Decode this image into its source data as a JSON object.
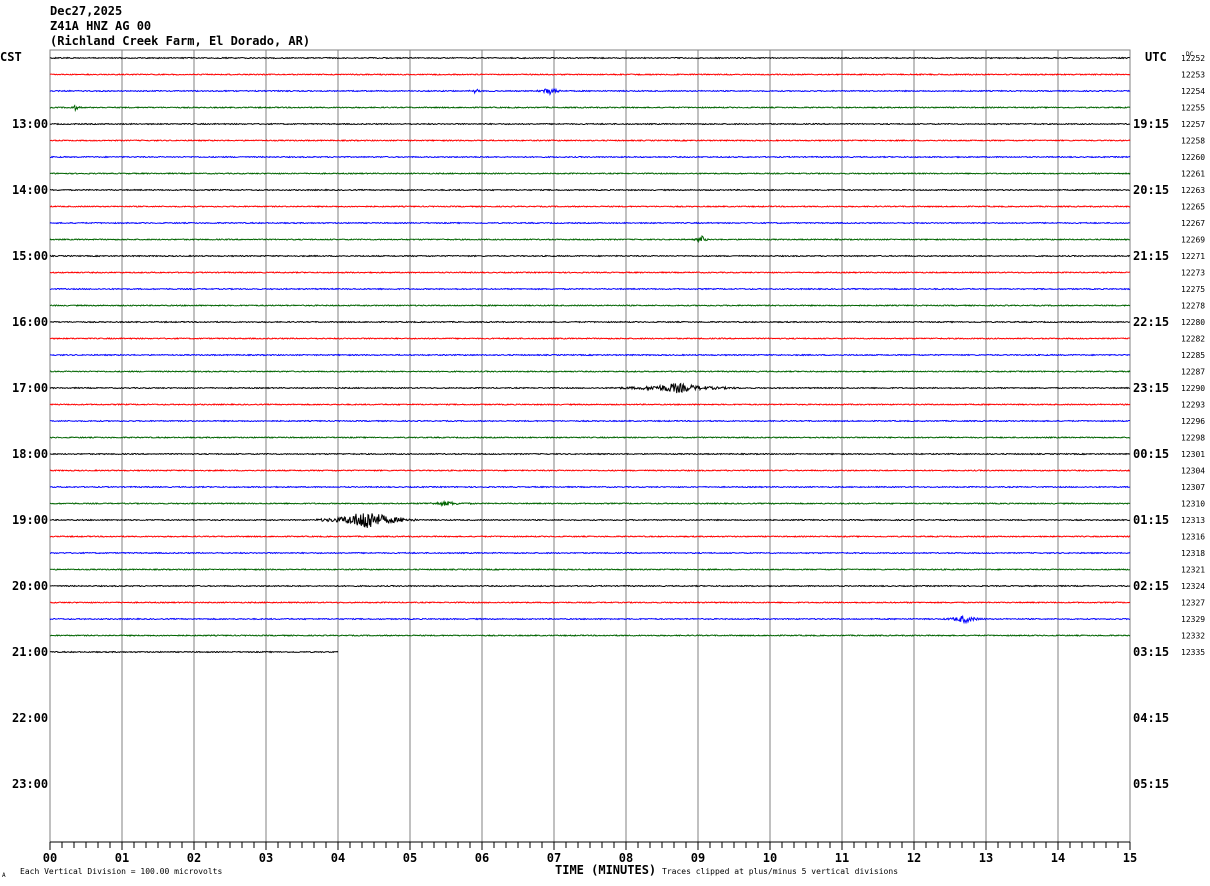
{
  "header": {
    "date": "Dec27,2025",
    "station": "Z41A HNZ AG 00",
    "location": "(Richland Creek Farm, El Dorado, AR)"
  },
  "left_timezone": "CST",
  "right_timezone": "UTC",
  "dc_header": "DC",
  "footer": {
    "scale_note": "Each Vertical Division =  100.00 microvolts",
    "xlabel": "TIME (MINUTES)",
    "clip_note": "Traces clipped at plus/minus 5 vertical divisions",
    "corner_mark": "A"
  },
  "colors": {
    "trace_cycle": [
      "#000000",
      "#ff0000",
      "#0000ff",
      "#006400"
    ],
    "grid": "#808080"
  },
  "chart_data": {
    "type": "line",
    "title": "Z41A HNZ AG 00 helicorder",
    "xlabel": "TIME (MINUTES)",
    "xlim": [
      0,
      15
    ],
    "x_ticks": [
      "00",
      "01",
      "02",
      "03",
      "04",
      "05",
      "06",
      "07",
      "08",
      "09",
      "10",
      "11",
      "12",
      "13",
      "14",
      "15"
    ],
    "left_hour_labels": [
      "13:00",
      "14:00",
      "15:00",
      "16:00",
      "17:00",
      "18:00",
      "19:00",
      "20:00",
      "21:00",
      "22:00",
      "23:00"
    ],
    "right_hour_labels": [
      "19:15",
      "20:15",
      "21:15",
      "22:15",
      "23:15",
      "00:15",
      "01:15",
      "02:15",
      "03:15",
      "04:15",
      "05:15"
    ],
    "trace_minutes": 15,
    "first_trace_start_cst": "12:00",
    "total_traces": 37,
    "last_trace_minutes": 4,
    "dc_offsets": [
      12252,
      12253,
      12254,
      12255,
      12257,
      12258,
      12260,
      12261,
      12263,
      12265,
      12267,
      12269,
      12271,
      12273,
      12275,
      12278,
      12280,
      12282,
      12285,
      12287,
      12290,
      12293,
      12296,
      12298,
      12301,
      12304,
      12307,
      12310,
      12313,
      12316,
      12318,
      12321,
      12324,
      12327,
      12329,
      12332,
      12335
    ],
    "events": [
      {
        "trace": 2,
        "minute": 5.9,
        "amplitude": 0.4,
        "duration": 0.1
      },
      {
        "trace": 2,
        "minute": 6.95,
        "amplitude": 0.6,
        "duration": 0.2
      },
      {
        "trace": 3,
        "minute": 0.35,
        "amplitude": 0.3,
        "duration": 0.1
      },
      {
        "trace": 11,
        "minute": 9.05,
        "amplitude": 0.5,
        "duration": 0.1
      },
      {
        "trace": 20,
        "minute": 8.7,
        "amplitude": 0.6,
        "duration": 0.9
      },
      {
        "trace": 27,
        "minute": 5.5,
        "amplitude": 0.25,
        "duration": 0.4
      },
      {
        "trace": 28,
        "minute": 4.4,
        "amplitude": 1.4,
        "duration": 0.7
      },
      {
        "trace": 34,
        "minute": 12.7,
        "amplitude": 0.5,
        "duration": 0.3
      }
    ]
  }
}
